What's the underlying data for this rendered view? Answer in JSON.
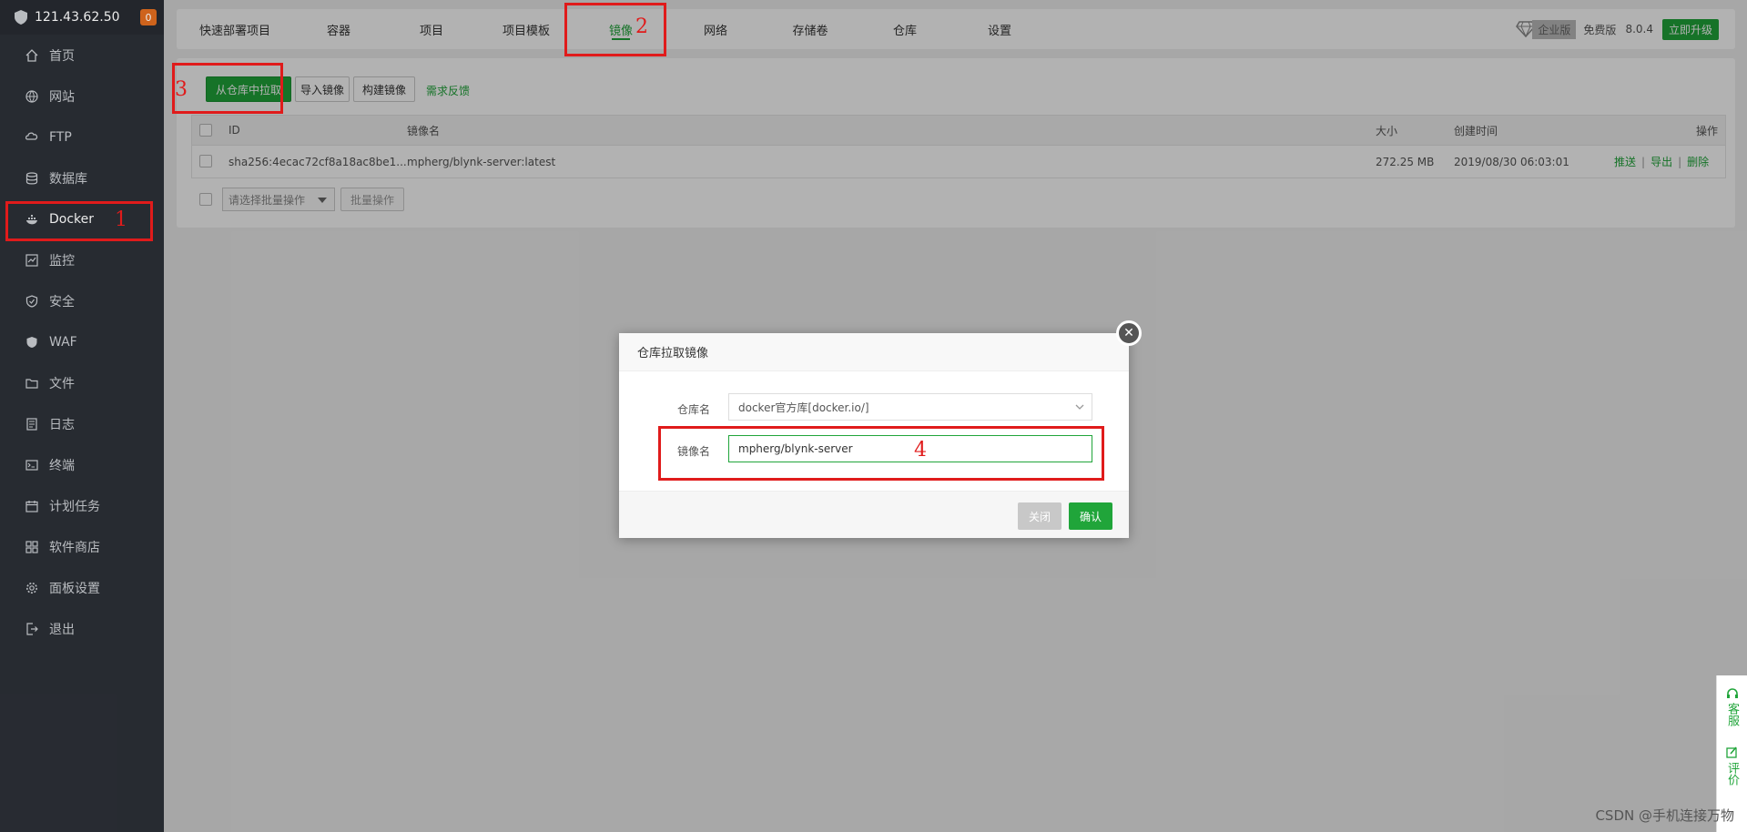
{
  "sidebar": {
    "server_ip": "121.43.62.50",
    "badge_count": "0",
    "items": [
      {
        "label": "首页",
        "icon": "home-icon"
      },
      {
        "label": "网站",
        "icon": "globe-icon"
      },
      {
        "label": "FTP",
        "icon": "ftp-icon"
      },
      {
        "label": "数据库",
        "icon": "database-icon"
      },
      {
        "label": "Docker",
        "icon": "docker-icon"
      },
      {
        "label": "监控",
        "icon": "monitor-icon"
      },
      {
        "label": "安全",
        "icon": "shield-icon"
      },
      {
        "label": "WAF",
        "icon": "waf-icon"
      },
      {
        "label": "文件",
        "icon": "folder-icon"
      },
      {
        "label": "日志",
        "icon": "log-icon"
      },
      {
        "label": "终端",
        "icon": "terminal-icon"
      },
      {
        "label": "计划任务",
        "icon": "calendar-icon"
      },
      {
        "label": "软件商店",
        "icon": "apps-icon"
      },
      {
        "label": "面板设置",
        "icon": "gear-icon"
      },
      {
        "label": "退出",
        "icon": "logout-icon"
      }
    ],
    "active": "Docker"
  },
  "topnav": {
    "tabs": [
      "快速部署项目",
      "容器",
      "项目",
      "项目模板",
      "镜像",
      "网络",
      "存储卷",
      "仓库",
      "设置"
    ],
    "active": "镜像",
    "edition_label": "企业版",
    "free_label": "免费版",
    "version": "8.0.4",
    "upgrade_label": "立即升级"
  },
  "toolbar": {
    "pull_label": "从仓库中拉取",
    "import_label": "导入镜像",
    "build_label": "构建镜像",
    "feedback_label": "需求反馈"
  },
  "table": {
    "headers": {
      "id": "ID",
      "name": "镜像名",
      "size": "大小",
      "created": "创建时间",
      "ops": "操作"
    },
    "rows": [
      {
        "id": "sha256:4ecac72cf8a18ac8be1...",
        "name": "mpherg/blynk-server:latest",
        "size": "272.25 MB",
        "created": "2019/08/30 06:03:01"
      }
    ],
    "ops": {
      "push": "推送",
      "export": "导出",
      "delete": "删除"
    },
    "batch_placeholder": "请选择批量操作",
    "batch_button": "批量操作"
  },
  "dialog": {
    "title": "仓库拉取镜像",
    "repo_label": "仓库名",
    "repo_value": "docker官方库[docker.io/]",
    "image_label": "镜像名",
    "image_value": "mpherg/blynk-server",
    "close_label": "关闭",
    "confirm_label": "确认"
  },
  "annotations": [
    "1",
    "2",
    "3",
    "4"
  ],
  "float": {
    "service": "客服",
    "review": "评价"
  },
  "watermark": "CSDN @手机连接万物",
  "colors": {
    "accent": "#20a53a",
    "sidebar": "#2b2f36",
    "annotation": "#e01b1b",
    "badge": "#e06c1f"
  }
}
